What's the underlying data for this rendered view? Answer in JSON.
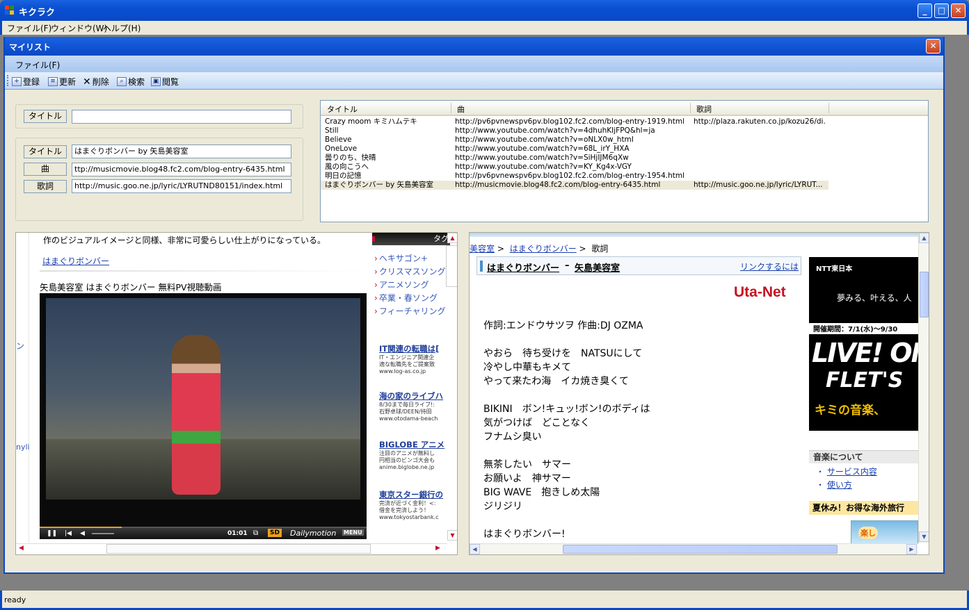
{
  "app": {
    "title": "キクラク",
    "menu": [
      "ファイル(F)",
      "ウィンドウ(W)",
      "ヘルプ(H)"
    ],
    "status": "ready"
  },
  "mylist": {
    "title": "マイリスト",
    "menu": [
      "ファイル(F)"
    ],
    "toolbar": [
      {
        "label": "登録",
        "icon": "register-icon"
      },
      {
        "label": "更新",
        "icon": "refresh-icon"
      },
      {
        "label": "削除",
        "icon": "delete-icon"
      },
      {
        "label": "検索",
        "icon": "search-icon"
      },
      {
        "label": "閲覧",
        "icon": "browse-icon"
      }
    ],
    "search": {
      "label": "タイトル",
      "value": ""
    },
    "detail": {
      "title_label": "タイトル",
      "title_value": "はまぐりボンバー by 矢島美容室",
      "song_label": "曲",
      "song_value": "ttp://musicmovie.blog48.fc2.com/blog-entry-6435.html",
      "lyrics_label": "歌詞",
      "lyrics_value": "http://music.goo.ne.jp/lyric/LYRUTND80151/index.html"
    },
    "list": {
      "columns": [
        "タイトル",
        "曲",
        "歌詞"
      ],
      "rows": [
        {
          "title": "Crazy moom キミハムテキ",
          "song": "http://pv6pvnewspv6pv.blog102.fc2.com/blog-entry-1919.html",
          "lyrics": "http://plaza.rakuten.co.jp/kozu26/di..."
        },
        {
          "title": "Still",
          "song": "http://www.youtube.com/watch?v=4dhuhKIjFPQ&hl=ja",
          "lyrics": ""
        },
        {
          "title": "Believe",
          "song": "http://www.youtube.com/watch?v=oNLX0w_htmI",
          "lyrics": ""
        },
        {
          "title": "OneLove",
          "song": "http://www.youtube.com/watch?v=68L_irY_HXA",
          "lyrics": ""
        },
        {
          "title": "曇りのち、快晴",
          "song": "http://www.youtube.com/watch?v=SiHjIJM6qXw",
          "lyrics": ""
        },
        {
          "title": "風の向こうへ",
          "song": "http://www.youtube.com/watch?v=KY_Kg4x-VGY",
          "lyrics": ""
        },
        {
          "title": "明日の記憶",
          "song": "http://pv6pvnewspv6pv.blog102.fc2.com/blog-entry-1954.html",
          "lyrics": ""
        },
        {
          "title": "はまぐりボンバー by 矢島美容室",
          "song": "http://musicmovie.blog48.fc2.com/blog-entry-6435.html",
          "lyrics": "http://music.goo.ne.jp/lyric/LYRUT..."
        }
      ]
    }
  },
  "left_page": {
    "intro_text": "作のビジュアルイメージと同様、非常に可愛らしい仕上がりになっている。",
    "link": "はまぐりボンバー",
    "video_heading": "矢島美容室 はまぐりボンバー 無料PV視聴動画",
    "side_fragment_1": "ン",
    "side_fragment_2": "nyli",
    "player": {
      "time": "01:01",
      "quality": "SD",
      "brand": "Dailymotion",
      "menu": "MENU",
      "progress": 0.25
    },
    "tags_header": "タグ",
    "tags": [
      "ヘキサゴン+",
      "クリスマスソング",
      "アニメソング",
      "卒業・春ソング",
      "フィーチャリング"
    ],
    "ads": [
      {
        "title": "IT関連の転職は[",
        "lines": [
          "IT・エンジニア関連企",
          "適な転職先をご提案致"
        ],
        "url": "www.log-as.co.jp"
      },
      {
        "title": "海の家のライブハ",
        "lines": [
          "8/30まで毎日ライブ!:",
          "石野卓球/DEEN/持田"
        ],
        "url": "www.otodama-beach"
      },
      {
        "title": "BIGLOBE アニメ",
        "lines": [
          "注目のアニメが無料し",
          "円相当のビンゴ大会も"
        ],
        "url": "anime.biglobe.ne.jp"
      },
      {
        "title": "東京スター銀行の",
        "lines": [
          "完済が近づく金利！<:",
          "借金を完済しよう！"
        ],
        "url": "www.tokyostarbank.c"
      }
    ]
  },
  "right_page": {
    "breadcrumb": [
      "美容室",
      "はまぐりボンバー",
      "歌詞"
    ],
    "song_title": "はまぐりボンバー",
    "artist": "矢島美容室",
    "link_label": "リンクするには",
    "logo": "Uta-Net",
    "credits": "作詞:エンドウサツヲ 作曲:DJ OZMA",
    "lyrics": [
      "やおら　待ち受けを　NATSUにして",
      "冷やし中華もキメて",
      "やって来たわ海　イカ焼き臭くて",
      "",
      "BIKINI　ボン!キュッ!ボン!のボディは",
      "気がつけば　どことなく",
      "フナムシ臭い",
      "",
      "無茶したい　サマー",
      "お願いよ　神サマー",
      "BIG WAVE　抱きしめ太陽",
      "ジリジリ",
      "",
      "はまぐりボンバー!"
    ],
    "banner": {
      "brand": "NTT東日本",
      "tagline": "夢みる、叶える、人",
      "period": "開催期間：7/1(水)～9/30",
      "headline1": "LIVE! ON",
      "headline2": "FLET'S",
      "footer": "キミの音楽、"
    },
    "music_about": {
      "title": "音楽について",
      "items": [
        "サービス内容",
        "使い方"
      ]
    },
    "travel_ad": "夏休み！お得な海外旅行",
    "travel_img_text": "楽し"
  }
}
